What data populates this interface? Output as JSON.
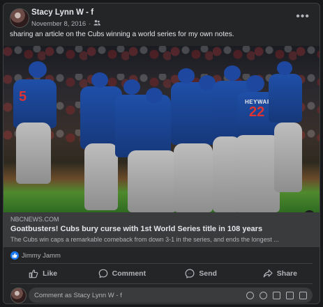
{
  "post": {
    "author": "Stacy Lynn W - f",
    "date": "November 8, 2016",
    "privacy_icon": "friends-icon",
    "caption": "sharing an article on the Cubs winning a world series for my own notes."
  },
  "link_preview": {
    "domain": "NBCNEWS.COM",
    "headline": "Goatbusters! Cubs bury curse with 1st World Series title in 108 years",
    "description": "The Cubs win caps a remarkable comeback from down 3-1 in the series, and ends the longest ..."
  },
  "photo": {
    "jersey_number": "22",
    "jersey_name": "HEYWARD",
    "jersey_number_left": "5"
  },
  "reactions": {
    "icon": "like-icon",
    "names": "Jimmy Jamm"
  },
  "actions": {
    "like": "Like",
    "comment": "Comment",
    "send": "Send",
    "share": "Share"
  },
  "comment_box": {
    "placeholder": "Comment as Stacy Lynn W - f",
    "icons": [
      "avatar-sticker-icon",
      "emoji-icon",
      "camera-icon",
      "gif-icon",
      "sticker-icon"
    ]
  },
  "colors": {
    "background": "#18191a",
    "card": "#242526",
    "accent": "#1877f2"
  }
}
